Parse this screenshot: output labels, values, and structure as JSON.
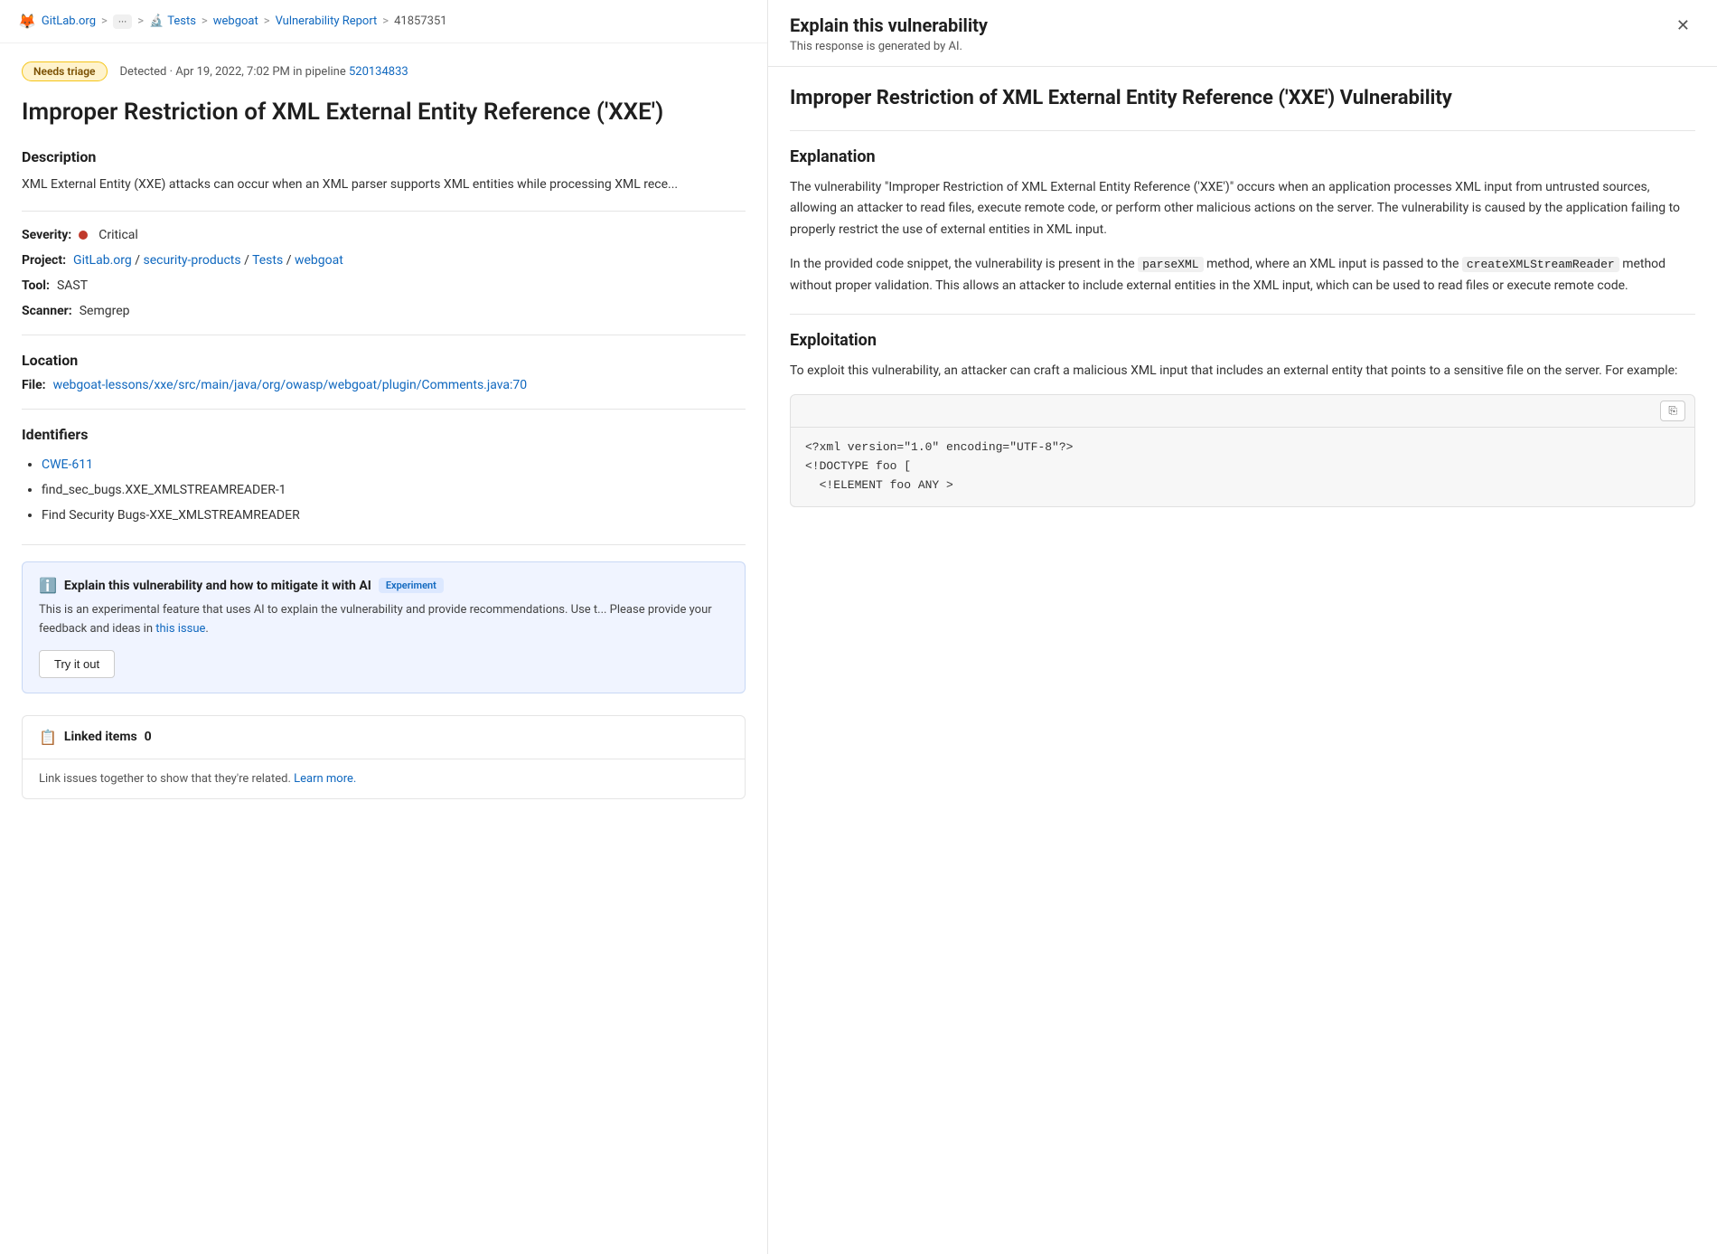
{
  "breadcrumb": {
    "gitlab_label": "GitLab.org",
    "dots": "···",
    "tests": "Tests",
    "webgoat": "webgoat",
    "vuln_report": "Vulnerability Report",
    "issue_id": "41857351"
  },
  "left": {
    "badge": "Needs triage",
    "detected_prefix": "Detected · Apr 19, 2022, 7:02 PM in pipeline",
    "pipeline_link_text": "520134833",
    "vuln_title": "Improper Restriction of XML External Entity Reference ('XXE')",
    "description_heading": "Description",
    "description_text": "XML External Entity (XXE) attacks can occur when an XML parser supports XML entities while processing XML rece...",
    "severity_label": "Severity:",
    "severity_dot_color": "#c0392b",
    "severity_value": "Critical",
    "project_label": "Project:",
    "project_parts": [
      "GitLab.org",
      "/",
      "security-products",
      "/",
      "Tests",
      "/",
      "webgoat"
    ],
    "tool_label": "Tool:",
    "tool_value": "SAST",
    "scanner_label": "Scanner:",
    "scanner_value": "Semgrep",
    "location_heading": "Location",
    "file_label": "File:",
    "file_path": "webgoat-lessons/xxe/src/main/java/org/owasp/webgoat/plugin/Comments.java:70",
    "identifiers_heading": "Identifiers",
    "identifiers": [
      {
        "text": "CWE-611",
        "is_link": true
      },
      {
        "text": "find_sec_bugs.XXE_XMLSTREAMREADER-1",
        "is_link": false
      },
      {
        "text": "Find Security Bugs-XXE_XMLSTREAMREADER",
        "is_link": false
      }
    ],
    "ai_box": {
      "title": "Explain this vulnerability and how to mitigate it with AI",
      "badge": "Experiment",
      "desc": "This is an experimental feature that uses AI to explain the vulnerability and provide recommendations. Use t... Please provide your feedback and ideas in",
      "this_issue_link": "this issue",
      "period": ".",
      "try_btn": "Try it out"
    },
    "linked_items": {
      "heading": "Linked items",
      "count": "0",
      "body_text": "Link issues together to show that they're related.",
      "learn_more": "Learn more."
    }
  },
  "right": {
    "panel_title": "Explain this vulnerability",
    "ai_note": "This response is generated by AI.",
    "vuln_title": "Improper Restriction of XML External Entity Reference ('XXE') Vulnerability",
    "explanation_heading": "Explanation",
    "explanation_p1": "The vulnerability \"Improper Restriction of XML External Entity Reference ('XXE')\" occurs when an application processes XML input from untrusted sources, allowing an attacker to read files, execute remote code, or perform other malicious actions on the server. The vulnerability is caused by the application failing to properly restrict the use of external entities in XML input.",
    "explanation_p2_before": "In the provided code snippet, the vulnerability is present in the",
    "explanation_p2_code1": "parseXML",
    "explanation_p2_mid": "method, where an XML input is passed to the",
    "explanation_p2_code2": "createXMLStreamReader",
    "explanation_p2_after": "method without proper validation. This allows an attacker to include external entities in the XML input, which can be used to read files or execute remote code.",
    "exploitation_heading": "Exploitation",
    "exploitation_text": "To exploit this vulnerability, an attacker can craft a malicious XML input that includes an external entity that points to a sensitive file on the server. For example:",
    "code_line1": "<?xml version=\"1.0\" encoding=\"UTF-8\"?>",
    "code_line2": "<!DOCTYPE foo [",
    "code_line3": "  <!ELEMENT foo ANY >"
  }
}
